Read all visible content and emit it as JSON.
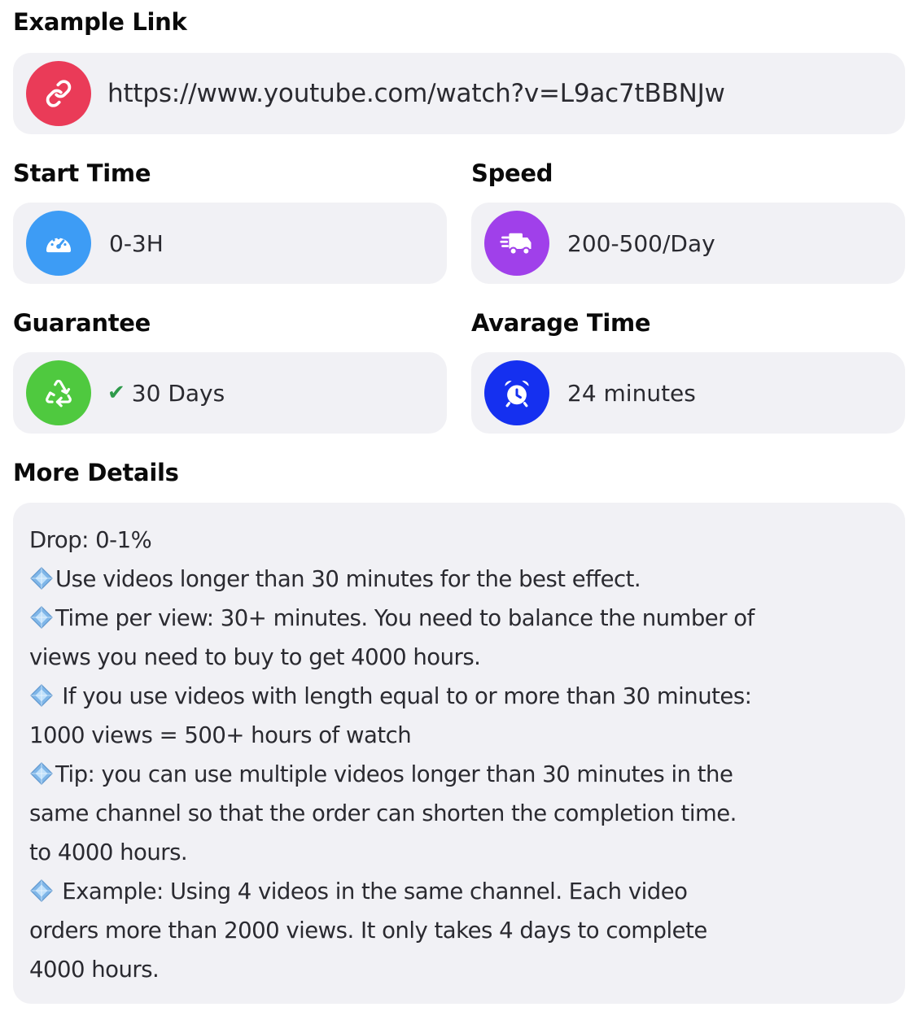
{
  "example_link": {
    "label": "Example Link",
    "url": "https://www.youtube.com/watch?v=L9ac7tBBNJw",
    "icon": "link-icon",
    "icon_color": "#ea3b58"
  },
  "start_time": {
    "label": "Start Time",
    "value": "0-3H",
    "icon": "speedometer-icon",
    "icon_color": "#3d9cf5"
  },
  "speed": {
    "label": "Speed",
    "value": "200-500/Day",
    "icon": "delivery-truck-icon",
    "icon_color": "#a040ea"
  },
  "guarantee": {
    "label": "Guarantee",
    "value": "30 Days",
    "icon": "recycle-icon",
    "icon_color": "#4fc93f",
    "check_color": "#2e9a4a"
  },
  "average_time": {
    "label": "Avarage Time",
    "value": "24 minutes",
    "icon": "alarm-clock-icon",
    "icon_color": "#1530f0"
  },
  "more_details": {
    "label": "More Details",
    "lines": [
      {
        "gem": false,
        "text": "Drop: 0-1%"
      },
      {
        "gem": true,
        "text": "Use videos longer than 30 minutes for the best effect."
      },
      {
        "gem": true,
        "text": "Time per view: 30+ minutes. You need to balance the number of"
      },
      {
        "gem": false,
        "text": "views you need to buy to get 4000 hours."
      },
      {
        "gem": true,
        "text": " If you use videos with length equal to or more than 30 minutes:"
      },
      {
        "gem": false,
        "text": "1000 views = 500+ hours of watch"
      },
      {
        "gem": true,
        "text": "Tip: you can use multiple videos longer than 30 minutes in the"
      },
      {
        "gem": false,
        "text": "same channel so that the order can shorten the completion time."
      },
      {
        "gem": false,
        "text": "to 4000 hours."
      },
      {
        "gem": true,
        "text": " Example: Using 4 videos in the same channel. Each video"
      },
      {
        "gem": false,
        "text": "orders more than 2000 views. It only takes 4 days to complete"
      },
      {
        "gem": false,
        "text": "4000 hours."
      }
    ]
  }
}
